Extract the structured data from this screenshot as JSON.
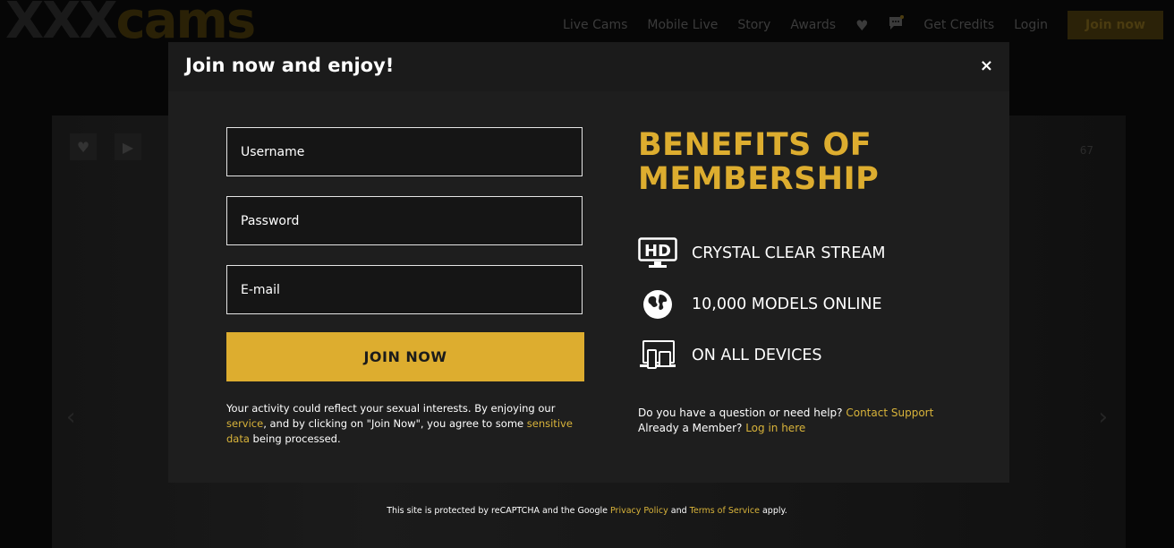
{
  "header": {
    "logo_part1": "XXX",
    "logo_part2": "cams",
    "nav": [
      "Live Cams",
      "Mobile Live",
      "Story",
      "Awards"
    ],
    "icons": [
      "heart-icon",
      "chat-icon"
    ],
    "get_credits": "Get Credits",
    "login": "Login",
    "join_now": "Join now"
  },
  "stage": {
    "count": "67"
  },
  "modal": {
    "title": "Join now and enjoy!",
    "close": "×",
    "form": {
      "username_placeholder": "Username",
      "password_placeholder": "Password",
      "email_placeholder": "E-mail",
      "submit_label": "JOIN NOW"
    },
    "legal": {
      "part1": "Your activity could reflect your sexual interests. By enjoying our ",
      "link1": "service",
      "part2": ", and by clicking on \"Join Now\", you agree to some ",
      "link2": "sensitive data",
      "part3": " being processed."
    },
    "benefits": {
      "title_line1": "BENEFITS OF",
      "title_line2": "MEMBERSHIP",
      "items": [
        {
          "icon": "hd-screen-icon",
          "label": "CRYSTAL CLEAR STREAM"
        },
        {
          "icon": "globe-icon",
          "label": "10,000 MODELS ONLINE"
        },
        {
          "icon": "devices-icon",
          "label": "ON ALL DEVICES"
        }
      ]
    },
    "help": {
      "question": "Do you have a question or need help? ",
      "support_link": "Contact Support",
      "member": "Already a Member? ",
      "login_link": "Log in here"
    }
  },
  "recaptcha": {
    "part1": "This site is protected by reCAPTCHA and the Google ",
    "privacy_link": "Privacy Policy",
    "part2": " and ",
    "terms_link": "Terms of Service",
    "part3": " apply."
  },
  "colors": {
    "accent": "#ddad2f",
    "link": "#d8b33a",
    "modal_bg": "#1e1e1e"
  }
}
